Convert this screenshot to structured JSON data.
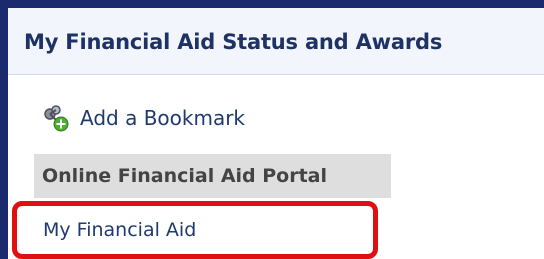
{
  "panel": {
    "title": "My Financial Aid Status and Awards",
    "bookmark": {
      "label": "Add a Bookmark",
      "icon": "add-bookmark-icon"
    },
    "section": {
      "label": "Online Financial Aid Portal"
    },
    "links": [
      {
        "label": "My Financial Aid"
      }
    ]
  },
  "colors": {
    "title": "#1e3265",
    "link": "#1e3a6f",
    "highlight": "#e01010",
    "section_bg": "#dedede",
    "outer_frame": "#1a2a6c"
  }
}
